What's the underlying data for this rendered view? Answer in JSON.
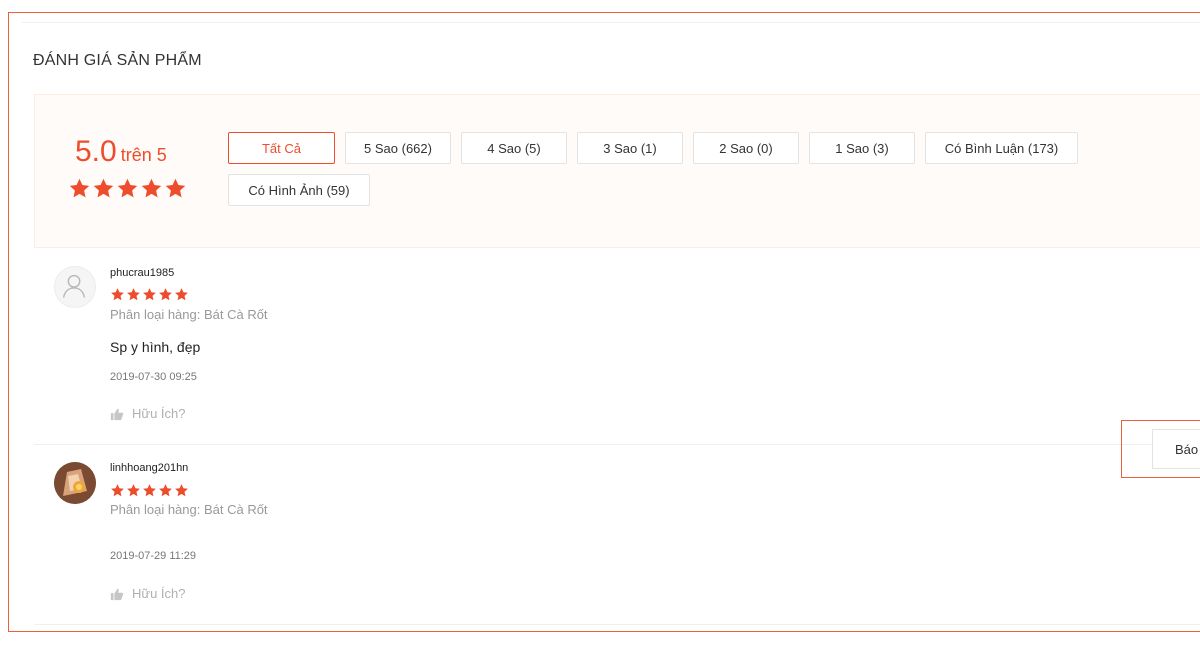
{
  "section_title": "ĐÁNH GIÁ SẢN PHẨM",
  "overview": {
    "score": "5.0",
    "score_suffix": "trên 5",
    "rating": 5,
    "filters": [
      {
        "label": "Tất Cả",
        "active": true
      },
      {
        "label": "5 Sao (662)",
        "active": false
      },
      {
        "label": "4 Sao (5)",
        "active": false
      },
      {
        "label": "3 Sao (1)",
        "active": false
      },
      {
        "label": "2 Sao (0)",
        "active": false
      },
      {
        "label": "1 Sao (3)",
        "active": false
      },
      {
        "label": "Có Bình Luận (173)",
        "active": false
      },
      {
        "label": "Có Hình Ảnh (59)",
        "active": false
      }
    ]
  },
  "reviews": [
    {
      "username": "phucrau1985",
      "rating": 5,
      "variation": "Phân loại hàng: Bát Cà Rốt",
      "comment": "Sp y hình, đẹp",
      "timestamp": "2019-07-30 09:25",
      "helpful_label": "Hữu Ích?",
      "avatar": "default-avatar-icon"
    },
    {
      "username": "linhhoang201hn",
      "rating": 5,
      "variation": "Phân loại hàng: Bát Cà Rốt",
      "comment": "",
      "timestamp": "2019-07-29 11:29",
      "helpful_label": "Hữu Ích?",
      "avatar": "user-photo-avatar"
    }
  ],
  "report_button_label": "Báo",
  "colors": {
    "accent": "#ee4d2d",
    "overview_bg": "#fffbf8",
    "highlight_border": "#e8603c",
    "muted_text": "#999999"
  }
}
